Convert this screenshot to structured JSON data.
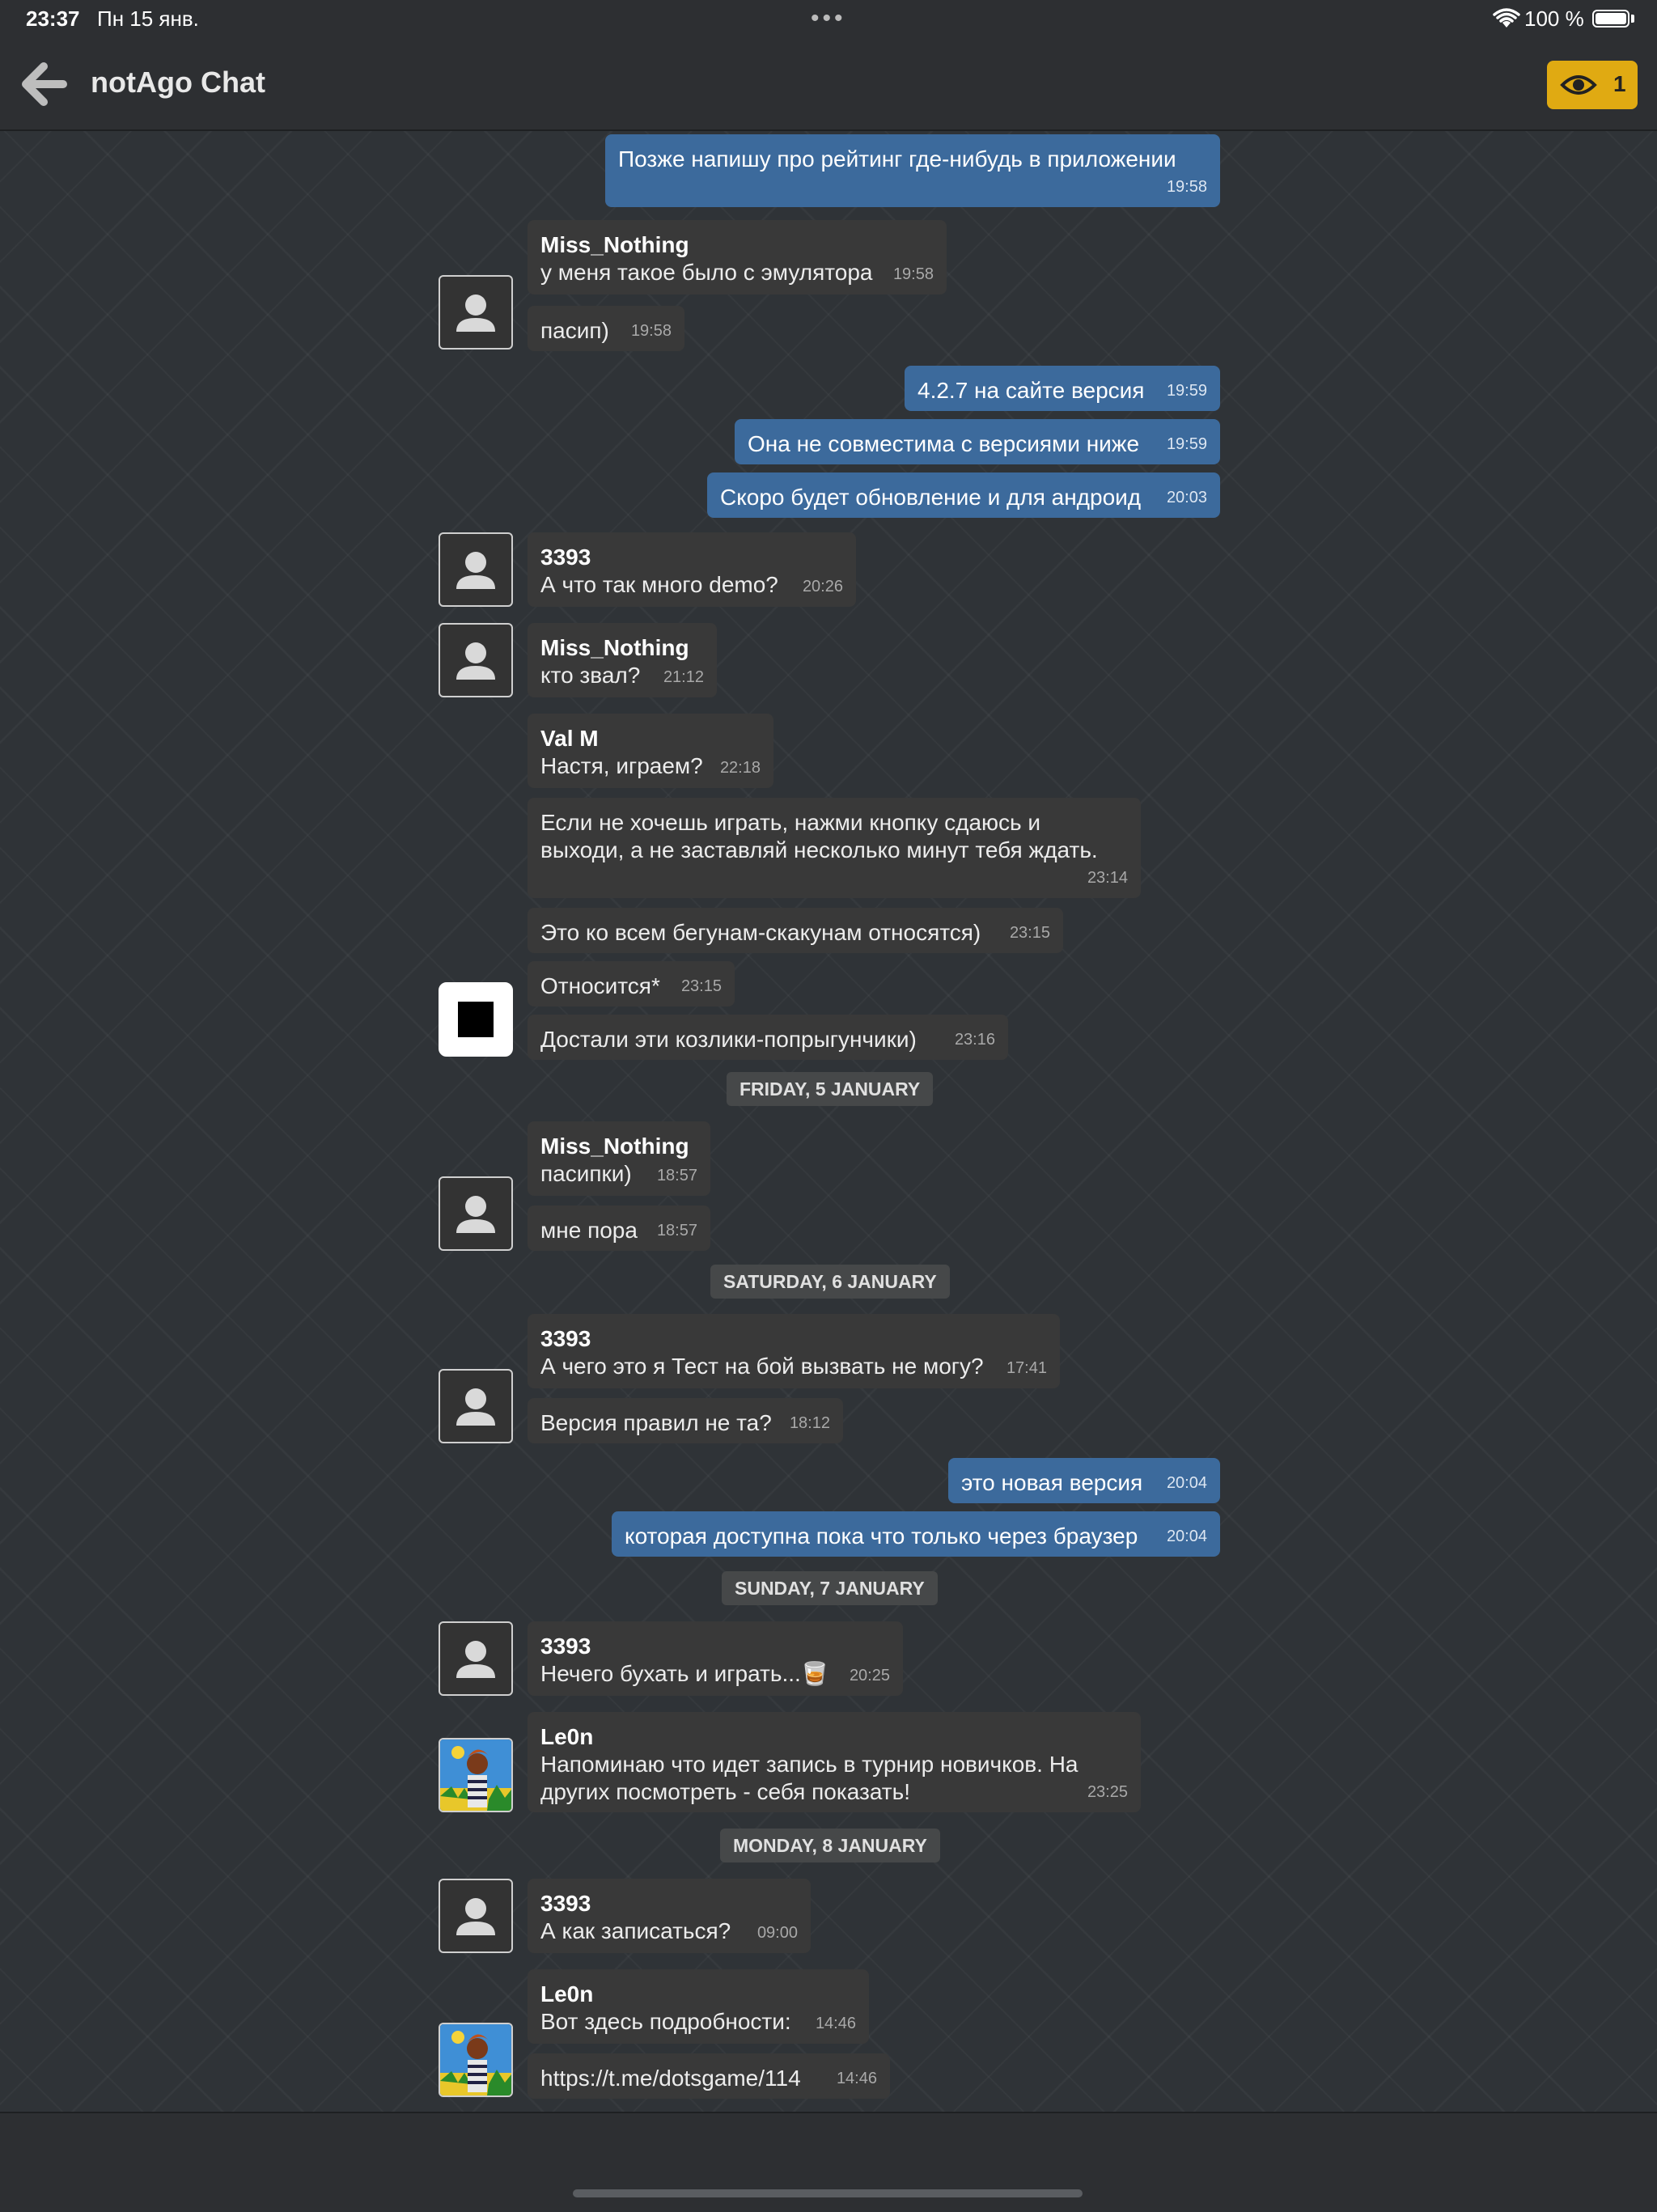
{
  "status": {
    "time": "23:37",
    "date": "Пн 15 янв.",
    "battery": "100 %"
  },
  "header": {
    "title": "notAgo Chat",
    "viewers": "1"
  },
  "dates": {
    "d1": "FRIDAY, 5 JANUARY",
    "d2": "SATURDAY, 6 JANUARY",
    "d3": "SUNDAY, 7 JANUARY",
    "d4": "MONDAY, 8 JANUARY"
  },
  "messages": [
    {
      "text": "Позже напишу про рейтинг где-нибудь в приложении",
      "time": "19:58",
      "outgoing": true
    },
    {
      "author": "Miss_Nothing",
      "text": "у меня такое было с эмулятора",
      "time": "19:58"
    },
    {
      "text": "пасип)",
      "time": "19:58"
    },
    {
      "text": "4.2.7 на сайте версия",
      "time": "19:59",
      "outgoing": true
    },
    {
      "text": "Она не совместима с версиями ниже",
      "time": "19:59",
      "outgoing": true
    },
    {
      "text": "Скоро будет обновление и для андроид",
      "time": "20:03",
      "outgoing": true
    },
    {
      "author": "3393",
      "text": "А что так много demo?",
      "time": "20:26"
    },
    {
      "author": "Miss_Nothing",
      "text": "кто звал?",
      "time": "21:12"
    },
    {
      "author": "Val M",
      "text": "Настя, играем?",
      "time": "22:18"
    },
    {
      "text": "Если не хочешь играть, нажми кнопку сдаюсь и выходи, а не заставляй несколько минут тебя ждать.",
      "time": "23:14"
    },
    {
      "text": "Это ко всем бегунам-скакунам относятся)",
      "time": "23:15"
    },
    {
      "text": "Относится*",
      "time": "23:15"
    },
    {
      "text": "Достали эти козлики-попрыгунчики)",
      "time": "23:16"
    },
    {
      "author": "Miss_Nothing",
      "text": "пасипки)",
      "time": "18:57"
    },
    {
      "text": "мне пора",
      "time": "18:57"
    },
    {
      "author": "3393",
      "text": "А чего это я Тест на бой вызвать не могу?",
      "time": "17:41"
    },
    {
      "text": "Версия правил не та?",
      "time": "18:12"
    },
    {
      "text": "это новая версия",
      "time": "20:04",
      "outgoing": true
    },
    {
      "text": "которая доступна пока что только через браузер",
      "time": "20:04",
      "outgoing": true
    },
    {
      "author": "3393",
      "text": "Нечего бухать и играть...",
      "emoji": "🥃",
      "time": "20:25"
    },
    {
      "author": "Le0n",
      "text": "Напоминаю что идет запись в турнир новичков. На других посмотреть - себя показать!",
      "time": "23:25"
    },
    {
      "author": "3393",
      "text": "А как записаться?",
      "time": "09:00"
    },
    {
      "author": "Le0n",
      "text": "Вот здесь подробности:",
      "time": "14:46"
    },
    {
      "text": "https://t.me/dotsgame/114",
      "time": "14:46"
    }
  ]
}
